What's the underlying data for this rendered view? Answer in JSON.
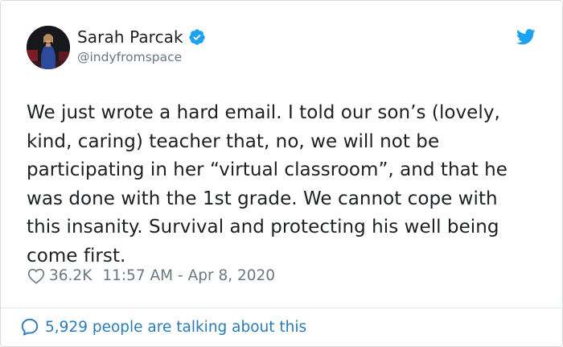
{
  "author": {
    "display_name": "Sarah Parcak",
    "handle": "@indyfromspace",
    "verified": true,
    "avatar_icon": "profile-photo"
  },
  "tweet": {
    "text": "We just wrote a hard email. I told our son’s (lovely,\nkind, caring) teacher that, no, we will not be\nparticipating in her “virtual classroom”, and that he\nwas done with the 1st grade. We cannot cope with\nthis insanity. Survival and protecting his well being\ncome first.",
    "likes": "36.2K",
    "timestamp": "11:57 AM - Apr 8, 2020"
  },
  "footer": {
    "conversation_label": "5,929 people are talking about this"
  },
  "colors": {
    "brand_blue": "#1da1f2",
    "link_blue": "#2b7bb9",
    "muted_gray": "#697882"
  },
  "icons": {
    "logo": "twitter-bird-icon",
    "verified": "verified-badge-icon",
    "like": "heart-icon",
    "reply": "speech-bubble-icon"
  }
}
